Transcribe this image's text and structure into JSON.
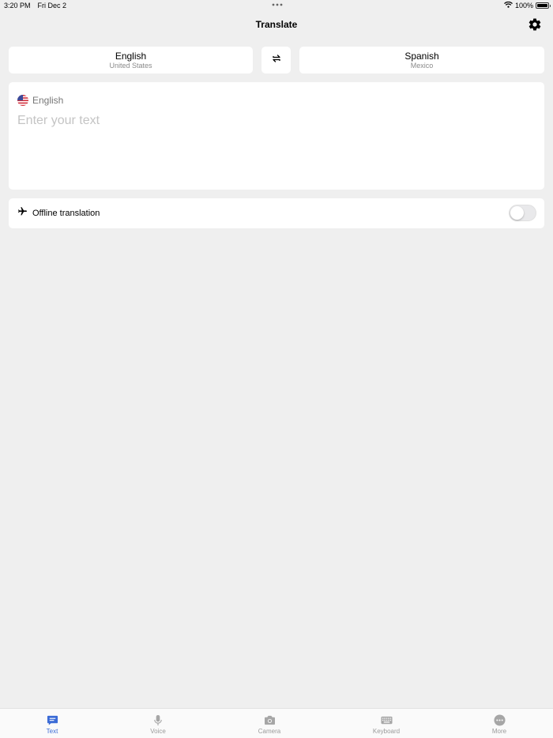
{
  "status_bar": {
    "time": "3:20 PM",
    "date": "Fri Dec 2",
    "battery": "100%",
    "battery_level": 1.0
  },
  "nav": {
    "title": "Translate",
    "settings_icon": "gear-icon"
  },
  "languages": {
    "source": {
      "name": "English",
      "region": "United States"
    },
    "target": {
      "name": "Spanish",
      "region": "Mexico"
    },
    "swap_icon": "swap-arrows-icon"
  },
  "input": {
    "language": "English",
    "flag_icon": "us-flag-icon",
    "placeholder": "Enter your text",
    "value": ""
  },
  "offline": {
    "label": "Offline translation",
    "icon": "airplane-icon",
    "enabled": false
  },
  "tabs": [
    {
      "label": "Text",
      "icon": "text-bubble-icon",
      "active": true
    },
    {
      "label": "Voice",
      "icon": "microphone-icon",
      "active": false
    },
    {
      "label": "Camera",
      "icon": "camera-icon",
      "active": false
    },
    {
      "label": "Keyboard",
      "icon": "keyboard-icon",
      "active": false
    },
    {
      "label": "More",
      "icon": "more-icon",
      "active": false
    }
  ],
  "colors": {
    "background": "#efefef",
    "card": "#ffffff",
    "accent": "#3b6bd6",
    "inactive": "#9a9a9a"
  }
}
